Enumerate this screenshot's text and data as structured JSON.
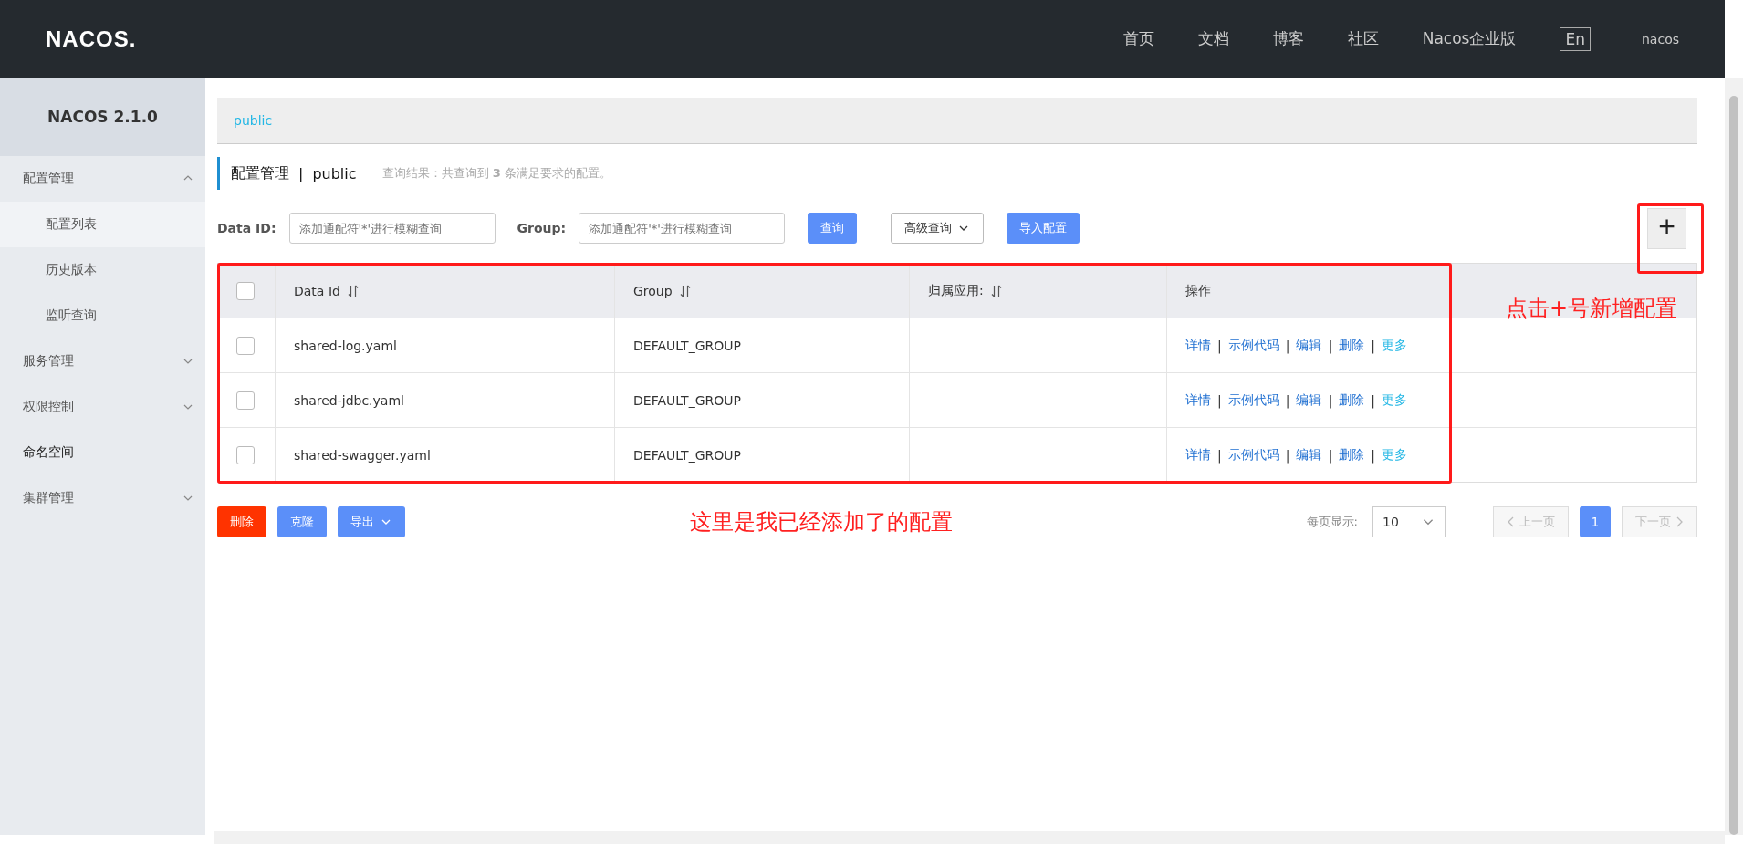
{
  "header": {
    "logo": "NACOS.",
    "nav": [
      "首页",
      "文档",
      "博客",
      "社区",
      "Nacos企业版"
    ],
    "lang_button": "En",
    "user": "nacos"
  },
  "sidebar": {
    "title": "NACOS 2.1.0",
    "items": [
      {
        "label": "配置管理",
        "kind": "group",
        "expanded": true,
        "children": [
          {
            "label": "配置列表",
            "selected": true
          },
          {
            "label": "历史版本",
            "selected": false
          },
          {
            "label": "监听查询",
            "selected": false
          }
        ]
      },
      {
        "label": "服务管理",
        "kind": "group",
        "expanded": false
      },
      {
        "label": "权限控制",
        "kind": "group",
        "expanded": false
      },
      {
        "label": "命名空间",
        "kind": "link"
      },
      {
        "label": "集群管理",
        "kind": "group",
        "expanded": false
      }
    ]
  },
  "namespace_bar": {
    "items": [
      "public"
    ]
  },
  "page_title": {
    "title": "配置管理",
    "separator": "|",
    "namespace": "public",
    "result": "查询结果：共查询到 **3** 条满足要求的配置。"
  },
  "filters": {
    "data_id_label": "Data ID:",
    "data_id_placeholder": "添加通配符'*'进行模糊查询",
    "group_label": "Group:",
    "group_placeholder": "添加通配符'*'进行模糊查询",
    "query_button": "查询",
    "advanced_button": "高级查询",
    "import_button": "导入配置",
    "add_button": "+"
  },
  "table": {
    "columns": [
      "Data Id",
      "Group",
      "归属应用:",
      "操作"
    ],
    "all_checked": false,
    "rows": [
      {
        "checked": false,
        "data_id": "shared-log.yaml",
        "group": "DEFAULT_GROUP",
        "actions": [
          "详情",
          "示例代码",
          "编辑",
          "删除",
          "更多"
        ],
        "separators": [
          "|",
          "|",
          "|",
          "|"
        ]
      },
      {
        "checked": false,
        "data_id": "shared-jdbc.yaml",
        "group": "DEFAULT_GROUP",
        "actions": [
          "详情",
          "示例代码",
          "编辑",
          "删除",
          "更多"
        ],
        "separators": [
          "|",
          "|",
          "|",
          "|"
        ]
      },
      {
        "checked": false,
        "data_id": "shared-swagger.yaml",
        "group": "DEFAULT_GROUP",
        "actions": [
          "详情",
          "示例代码",
          "编辑",
          "删除",
          "更多"
        ],
        "separators": [
          "|",
          "|",
          "|",
          "|"
        ]
      }
    ]
  },
  "footer": {
    "delete_button": "删除",
    "clone_button": "克隆",
    "export_button": "导出",
    "page_size_label": "每页显示:",
    "page_size": "10",
    "prev": "上一页",
    "pages": [
      {
        "label": "1",
        "selected": true
      }
    ],
    "next": "下一页"
  },
  "annotations": [
    {
      "text": "点击+号新增配置"
    },
    {
      "text": "这里是我已经添加了的配置"
    }
  ]
}
